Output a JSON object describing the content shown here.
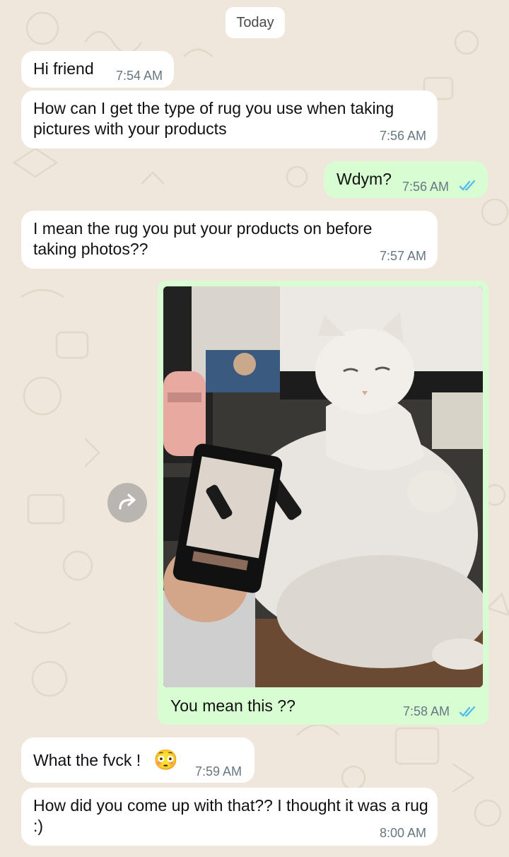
{
  "chat": {
    "date_separator": "Today",
    "messages": [
      {
        "id": "m1",
        "direction": "incoming",
        "text": "Hi friend",
        "time": "7:54 AM"
      },
      {
        "id": "m2",
        "direction": "incoming",
        "text": "How can I get the type of rug you use when taking pictures with your products",
        "time": "7:56 AM"
      },
      {
        "id": "m3",
        "direction": "outgoing",
        "text": "Wdym?",
        "time": "7:56 AM",
        "status": "read"
      },
      {
        "id": "m4",
        "direction": "incoming",
        "text": "I mean the rug you put your products on before taking photos??",
        "time": "7:57 AM"
      },
      {
        "id": "m5",
        "direction": "outgoing",
        "type": "image",
        "caption": "You mean this ??",
        "time": "7:58 AM",
        "status": "read",
        "image_subject": "cat-photo"
      },
      {
        "id": "m6",
        "direction": "incoming",
        "text": "What the fvck !",
        "emoji": "😳",
        "time": "7:59 AM"
      },
      {
        "id": "m7",
        "direction": "incoming",
        "text": "How did you come up with that?? I thought it was a rug :)",
        "time": "8:00 AM"
      }
    ]
  },
  "icons": {
    "read_receipt": "double-check-icon",
    "forward": "forward-icon"
  },
  "colors": {
    "wallpaper": "#efe7dc",
    "incoming_bubble": "#ffffff",
    "outgoing_bubble": "#d9fdd3",
    "read_ticks": "#53bdeb",
    "timestamp": "#667781"
  }
}
